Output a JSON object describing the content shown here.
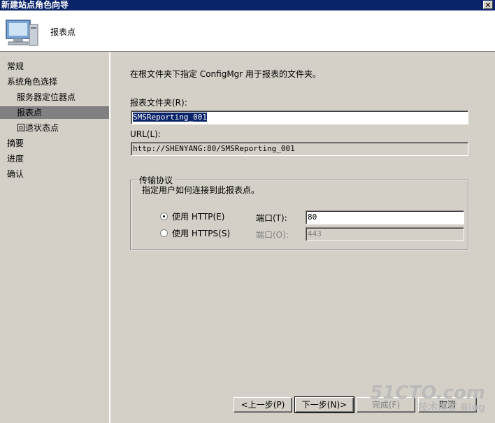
{
  "window": {
    "title": "新建站点角色向导",
    "close_glyph": "✕"
  },
  "header": {
    "title": "报表点",
    "icon": "computer-icon"
  },
  "nav": {
    "items": [
      {
        "label": "常规"
      },
      {
        "label": "系统角色选择"
      },
      {
        "label": "服务器定位器点"
      },
      {
        "label": "报表点"
      },
      {
        "label": "回退状态点"
      },
      {
        "label": "摘要"
      },
      {
        "label": "进度"
      },
      {
        "label": "确认"
      }
    ]
  },
  "main": {
    "intro": "在根文件夹下指定 ConfigMgr 用于报表的文件夹。",
    "report_folder": {
      "label": "报表文件夹(R):",
      "value": "SMSReporting_001"
    },
    "url": {
      "label": "URL(L):",
      "value": "http://SHENYANG:80/SMSReporting_001"
    },
    "protocol": {
      "title": "传输协议",
      "description": "指定用户如何连接到此报表点。",
      "http": {
        "label": "使用 HTTP(E)",
        "selected": true,
        "port_label": "端口(T):",
        "port_value": "80"
      },
      "https": {
        "label": "使用 HTTPS(S)",
        "selected": false,
        "port_label": "端口(O):",
        "port_value": "443"
      }
    }
  },
  "buttons": {
    "back": "<上一步(P)",
    "next": "下一步(N)>",
    "finish": "完成(F)",
    "cancel": "取消"
  },
  "watermark": {
    "line1": "51CTO.com",
    "line2": "技术博客 Blog"
  }
}
